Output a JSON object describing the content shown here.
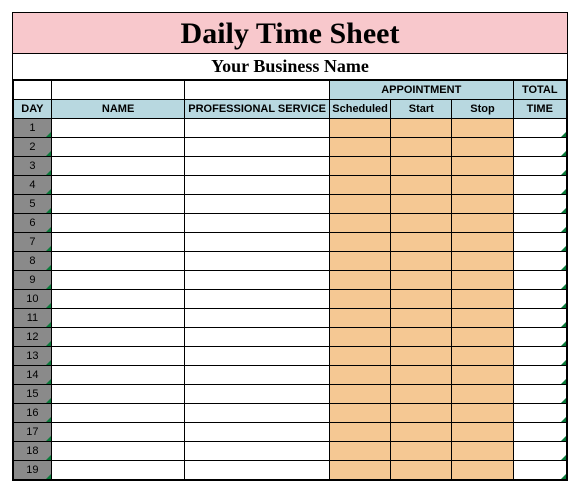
{
  "title": "Daily Time Sheet",
  "subtitle": "Your Business Name",
  "headers": {
    "day": "DAY",
    "name": "NAME",
    "professional_service": "PROFESSIONAL SERVICE",
    "appointment": "APPOINTMENT",
    "scheduled": "Scheduled",
    "start": "Start",
    "stop": "Stop",
    "total": "TOTAL",
    "time": "TIME"
  },
  "rows": [
    {
      "n": "1",
      "name": "",
      "service": "",
      "scheduled": "",
      "start": "",
      "stop": "",
      "total": ""
    },
    {
      "n": "2",
      "name": "",
      "service": "",
      "scheduled": "",
      "start": "",
      "stop": "",
      "total": ""
    },
    {
      "n": "3",
      "name": "",
      "service": "",
      "scheduled": "",
      "start": "",
      "stop": "",
      "total": ""
    },
    {
      "n": "4",
      "name": "",
      "service": "",
      "scheduled": "",
      "start": "",
      "stop": "",
      "total": ""
    },
    {
      "n": "5",
      "name": "",
      "service": "",
      "scheduled": "",
      "start": "",
      "stop": "",
      "total": ""
    },
    {
      "n": "6",
      "name": "",
      "service": "",
      "scheduled": "",
      "start": "",
      "stop": "",
      "total": ""
    },
    {
      "n": "7",
      "name": "",
      "service": "",
      "scheduled": "",
      "start": "",
      "stop": "",
      "total": ""
    },
    {
      "n": "8",
      "name": "",
      "service": "",
      "scheduled": "",
      "start": "",
      "stop": "",
      "total": ""
    },
    {
      "n": "9",
      "name": "",
      "service": "",
      "scheduled": "",
      "start": "",
      "stop": "",
      "total": ""
    },
    {
      "n": "10",
      "name": "",
      "service": "",
      "scheduled": "",
      "start": "",
      "stop": "",
      "total": ""
    },
    {
      "n": "11",
      "name": "",
      "service": "",
      "scheduled": "",
      "start": "",
      "stop": "",
      "total": ""
    },
    {
      "n": "12",
      "name": "",
      "service": "",
      "scheduled": "",
      "start": "",
      "stop": "",
      "total": ""
    },
    {
      "n": "13",
      "name": "",
      "service": "",
      "scheduled": "",
      "start": "",
      "stop": "",
      "total": ""
    },
    {
      "n": "14",
      "name": "",
      "service": "",
      "scheduled": "",
      "start": "",
      "stop": "",
      "total": ""
    },
    {
      "n": "15",
      "name": "",
      "service": "",
      "scheduled": "",
      "start": "",
      "stop": "",
      "total": ""
    },
    {
      "n": "16",
      "name": "",
      "service": "",
      "scheduled": "",
      "start": "",
      "stop": "",
      "total": ""
    },
    {
      "n": "17",
      "name": "",
      "service": "",
      "scheduled": "",
      "start": "",
      "stop": "",
      "total": ""
    },
    {
      "n": "18",
      "name": "",
      "service": "",
      "scheduled": "",
      "start": "",
      "stop": "",
      "total": ""
    },
    {
      "n": "19",
      "name": "",
      "service": "",
      "scheduled": "",
      "start": "",
      "stop": "",
      "total": ""
    }
  ]
}
